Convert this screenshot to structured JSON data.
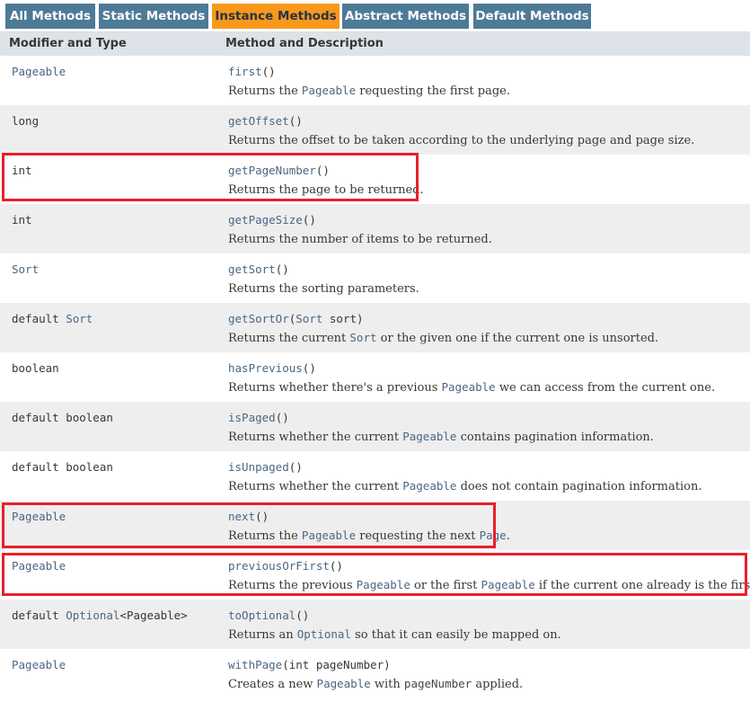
{
  "tabs": [
    "All Methods",
    "Static Methods",
    "Instance Methods",
    "Abstract Methods",
    "Default Methods"
  ],
  "header": {
    "col1": "Modifier and Type",
    "col2": "Method and Description"
  },
  "rows": [
    {
      "mod_a": "",
      "mod_link": "Pageable",
      "mod_b": "",
      "name": "first",
      "params_pre": "()",
      "params_link": "",
      "params_post": "",
      "d1": "Returns the ",
      "c1": "Pageable",
      "d2": " requesting the first page.",
      "c2": "",
      "d3": "",
      "c3": "",
      "d4": ""
    },
    {
      "mod_a": "long",
      "mod_link": "",
      "mod_b": "",
      "name": "getOffset",
      "params_pre": "()",
      "params_link": "",
      "params_post": "",
      "d1": "Returns the offset to be taken according to the underlying page and page size.",
      "c1": "",
      "d2": "",
      "c2": "",
      "d3": "",
      "c3": "",
      "d4": ""
    },
    {
      "mod_a": "int",
      "mod_link": "",
      "mod_b": "",
      "name": "getPageNumber",
      "params_pre": "()",
      "params_link": "",
      "params_post": "",
      "d1": "Returns the page to be returned.",
      "c1": "",
      "d2": "",
      "c2": "",
      "d3": "",
      "c3": "",
      "d4": ""
    },
    {
      "mod_a": "int",
      "mod_link": "",
      "mod_b": "",
      "name": "getPageSize",
      "params_pre": "()",
      "params_link": "",
      "params_post": "",
      "d1": "Returns the number of items to be returned.",
      "c1": "",
      "d2": "",
      "c2": "",
      "d3": "",
      "c3": "",
      "d4": ""
    },
    {
      "mod_a": "",
      "mod_link": "Sort",
      "mod_b": "",
      "name": "getSort",
      "params_pre": "()",
      "params_link": "",
      "params_post": "",
      "d1": "Returns the sorting parameters.",
      "c1": "",
      "d2": "",
      "c2": "",
      "d3": "",
      "c3": "",
      "d4": ""
    },
    {
      "mod_a": "default ",
      "mod_link": "Sort",
      "mod_b": "",
      "name": "getSortOr",
      "params_pre": "(",
      "params_link": "Sort",
      "params_post": " sort)",
      "d1": "Returns the current ",
      "c1": "Sort",
      "d2": " or the given one if the current one is unsorted.",
      "c2": "",
      "d3": "",
      "c3": "",
      "d4": ""
    },
    {
      "mod_a": "boolean",
      "mod_link": "",
      "mod_b": "",
      "name": "hasPrevious",
      "params_pre": "()",
      "params_link": "",
      "params_post": "",
      "d1": "Returns whether there's a previous ",
      "c1": "Pageable",
      "d2": " we can access from the current one.",
      "c2": "",
      "d3": "",
      "c3": "",
      "d4": ""
    },
    {
      "mod_a": "default boolean",
      "mod_link": "",
      "mod_b": "",
      "name": "isPaged",
      "params_pre": "()",
      "params_link": "",
      "params_post": "",
      "d1": "Returns whether the current ",
      "c1": "Pageable",
      "d2": " contains pagination information.",
      "c2": "",
      "d3": "",
      "c3": "",
      "d4": ""
    },
    {
      "mod_a": "default boolean",
      "mod_link": "",
      "mod_b": "",
      "name": "isUnpaged",
      "params_pre": "()",
      "params_link": "",
      "params_post": "",
      "d1": "Returns whether the current ",
      "c1": "Pageable",
      "d2": " does not contain pagination information.",
      "c2": "",
      "d3": "",
      "c3": "",
      "d4": ""
    },
    {
      "mod_a": "",
      "mod_link": "Pageable",
      "mod_b": "",
      "name": "next",
      "params_pre": "()",
      "params_link": "",
      "params_post": "",
      "d1": "Returns the ",
      "c1": "Pageable",
      "d2": " requesting the next ",
      "c2": "Page",
      "d3": ".",
      "c3": "",
      "d4": ""
    },
    {
      "mod_a": "",
      "mod_link": "Pageable",
      "mod_b": "",
      "name": "previousOrFirst",
      "params_pre": "()",
      "params_link": "",
      "params_post": "",
      "d1": "Returns the previous ",
      "c1": "Pageable",
      "d2": " or the first ",
      "c2": "Pageable",
      "d3": " if the current one already is the first one.",
      "c3": "",
      "d4": ""
    },
    {
      "mod_a": "default ",
      "mod_link": "Optional",
      "mod_b": "<Pageable>",
      "name": "toOptional",
      "params_pre": "()",
      "params_link": "",
      "params_post": "",
      "d1": "Returns an ",
      "c1": "Optional",
      "d2": " so that it can easily be mapped on.",
      "c2": "",
      "d3": "",
      "c3": "",
      "d4": ""
    },
    {
      "mod_a": "",
      "mod_link": "Pageable",
      "mod_b": "",
      "name": "withPage",
      "params_pre": "(int pageNumber)",
      "params_link": "",
      "params_post": "",
      "d1": "Creates a new ",
      "c1": "Pageable",
      "d2": " with ",
      "c2": "pageNumber",
      "d3": " applied.",
      "c3": "",
      "d4": ""
    }
  ],
  "colors": {
    "tab": "#4d7a97",
    "tab_active": "#f8981d",
    "highlight": "#e8202b",
    "link": "#4a6782",
    "row_alt": "#eeeeef",
    "header_bg": "#dee3e9"
  }
}
